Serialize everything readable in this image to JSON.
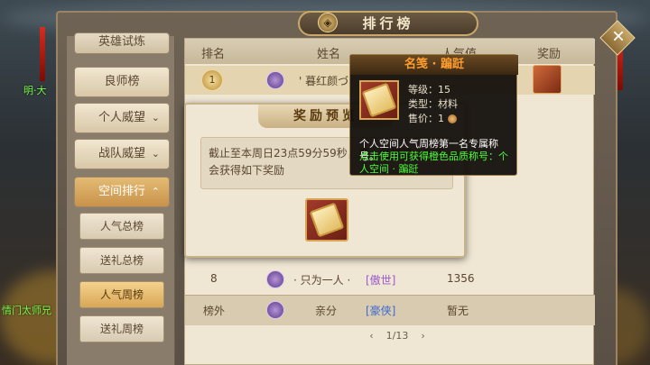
{
  "title": "排行榜",
  "nav": {
    "items": [
      {
        "label": "英雄试炼",
        "chevron": ""
      },
      {
        "label": "良师榜",
        "chevron": ""
      },
      {
        "label": "个人威望",
        "chevron": "⌄"
      },
      {
        "label": "战队威望",
        "chevron": "⌄"
      },
      {
        "label": "空间排行",
        "chevron": "⌃"
      }
    ],
    "subitems": [
      "人气总榜",
      "送礼总榜",
      "人气周榜",
      "送礼周榜"
    ]
  },
  "table": {
    "headers": {
      "rank": "排名",
      "name": "姓名",
      "popularity": "人气值",
      "reward": "奖励"
    },
    "rows": [
      {
        "rank": "1",
        "name": "' 暮红颜づ",
        "tag": "",
        "value": ""
      },
      {
        "rank": "8",
        "name": "· 只为一人 ·",
        "tag": "[傲世]",
        "value": "1356"
      },
      {
        "rank": "榜外",
        "name": "亲分",
        "tag": "[豪侠]",
        "value": "暂无"
      }
    ],
    "pager": "1/13"
  },
  "popup": {
    "title": "奖励预览",
    "text": "截止至本周日23点59分59秒，周人气榜第一名将会获得如下奖励"
  },
  "tooltip": {
    "title": "名笺 · 蹁跹",
    "level": "等级：15",
    "type": "类型：材料",
    "price": "售价：1",
    "desc": "个人空间人气周榜第一名专属称号。",
    "hint": "点击使用可获得橙色品质称号：个人空间 · 蹁跹"
  },
  "side": {
    "top": "明·大",
    "bottom": "情门太师兄"
  }
}
